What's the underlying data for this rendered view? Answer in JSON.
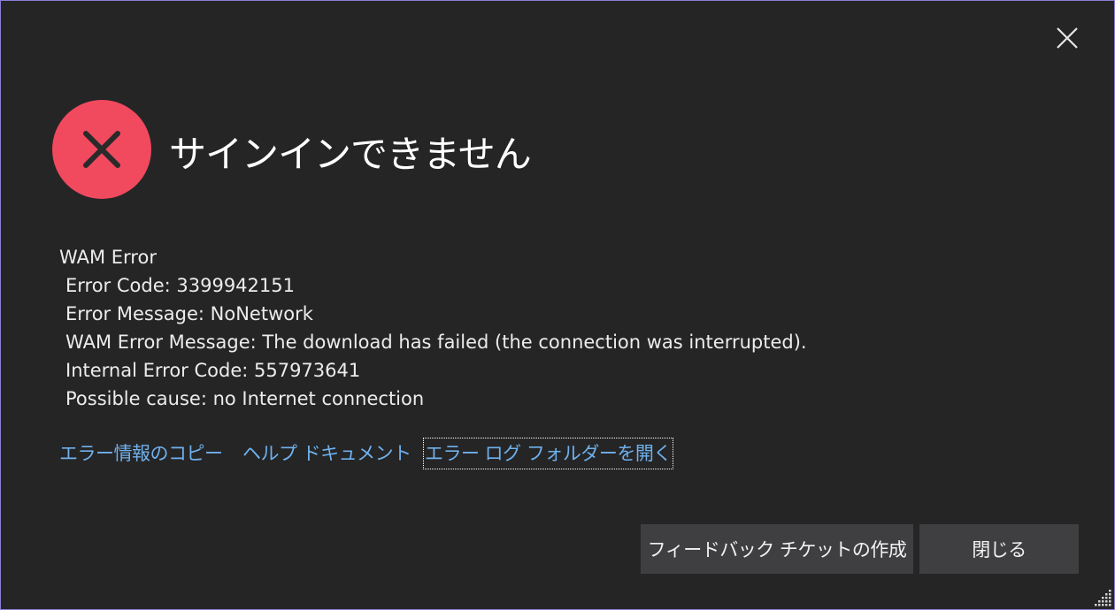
{
  "dialog": {
    "title": "サインインできません",
    "details": [
      "WAM Error",
      "Error Code: 3399942151",
      "Error Message: NoNetwork",
      "WAM Error Message: The download has failed (the connection was interrupted).",
      "Internal Error Code: 557973641",
      "Possible cause: no Internet connection"
    ],
    "links": {
      "copy_error": "エラー情報のコピー",
      "help_docs": "ヘルプ ドキュメント",
      "open_log_folder": "エラー ログ フォルダーを開く"
    },
    "buttons": {
      "feedback": "フィードバック チケットの作成",
      "close": "閉じる"
    }
  },
  "colors": {
    "background": "#252526",
    "border": "#8a7fd6",
    "error_icon": "#f1495e",
    "link": "#6fb1ec",
    "button": "#3f3f41"
  },
  "icons": {
    "close": "close-icon",
    "error": "error-x-icon",
    "resize": "resize-grip-icon"
  }
}
